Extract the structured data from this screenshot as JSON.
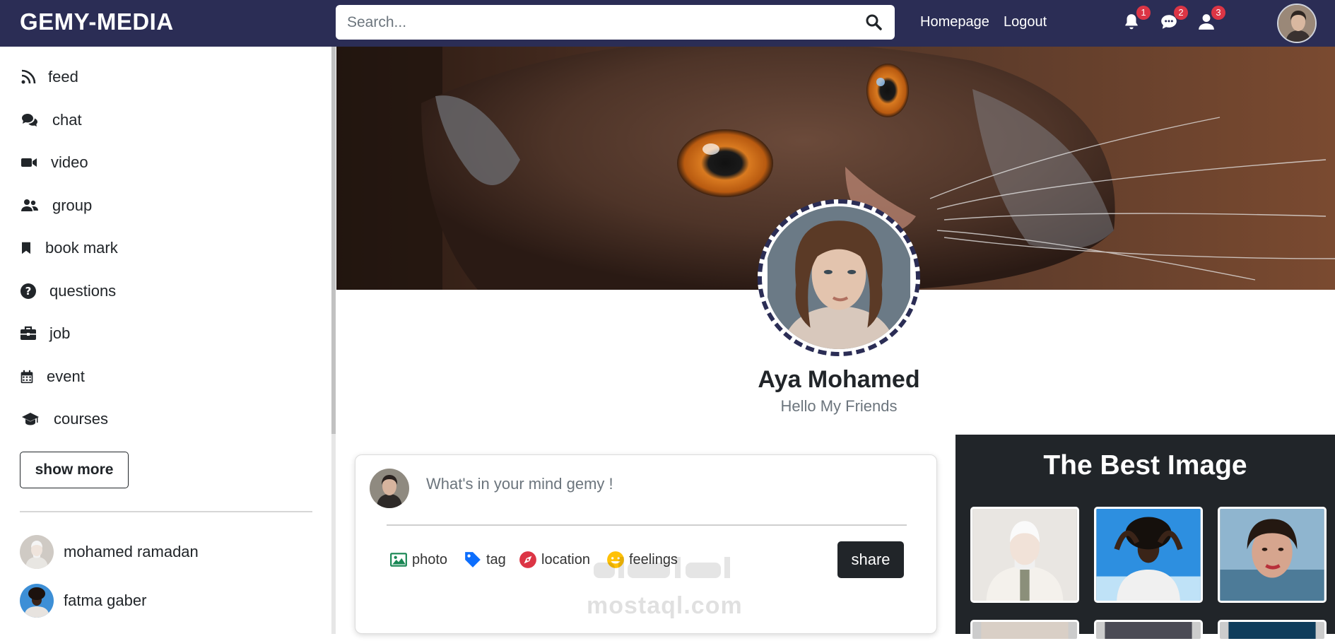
{
  "navbar": {
    "brand": "GEMY-MEDIA",
    "search_placeholder": "Search...",
    "links": [
      "Homepage",
      "Logout"
    ],
    "badges": {
      "notifications": "1",
      "messages": "2",
      "friends": "3"
    }
  },
  "sidebar": {
    "items": [
      {
        "label": "feed",
        "icon": "rss-icon"
      },
      {
        "label": "chat",
        "icon": "comments-icon"
      },
      {
        "label": "video",
        "icon": "video-icon"
      },
      {
        "label": "group",
        "icon": "user-group-icon"
      },
      {
        "label": "book mark",
        "icon": "bookmark-icon"
      },
      {
        "label": "questions",
        "icon": "question-circle-icon"
      },
      {
        "label": "job",
        "icon": "briefcase-icon"
      },
      {
        "label": "event",
        "icon": "calendar-icon"
      },
      {
        "label": "courses",
        "icon": "graduation-cap-icon"
      }
    ],
    "show_more": "show more",
    "friends": [
      "mohamed ramadan",
      "fatma gaber"
    ]
  },
  "profile": {
    "name": "Aya Mohamed",
    "bio": "Hello My Friends"
  },
  "post": {
    "placeholder": "What's in your mind gemy !",
    "options": [
      "photo",
      "tag",
      "location",
      "feelings"
    ],
    "share": "share"
  },
  "best_images": {
    "title": "The Best Image"
  },
  "watermark": "mostaql.com",
  "colors": {
    "navbar": "#2b2d55",
    "dark": "#212529",
    "badge": "#dc3545"
  }
}
